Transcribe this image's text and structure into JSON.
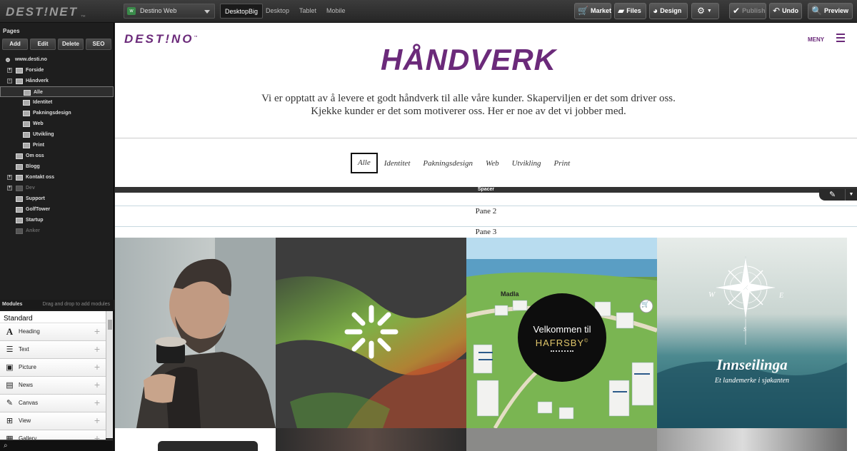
{
  "topbar": {
    "logo": "DEST!NET",
    "logo_tm": "™",
    "site_selector": "Destino Web",
    "site_icon": "w",
    "view_tabs": [
      "DesktopBig",
      "Desktop",
      "Tablet",
      "Mobile"
    ],
    "buttons": {
      "market": "Market",
      "files": "Files",
      "design": "Design",
      "publish": "Publish",
      "undo": "Undo",
      "preview": "Preview"
    }
  },
  "sidebar": {
    "pages_title": "Pages",
    "page_actions": [
      "Add",
      "Edit",
      "Delete",
      "SEO"
    ],
    "tree": [
      {
        "label": "www.desti.no",
        "level": 0,
        "expander": "",
        "icon": "globe"
      },
      {
        "label": "Forside",
        "level": 1,
        "expander": "+"
      },
      {
        "label": "Håndverk",
        "level": 1,
        "expander": "-"
      },
      {
        "label": "Alle",
        "level": 2,
        "expander": "",
        "selected": true
      },
      {
        "label": "Identitet",
        "level": 2,
        "expander": ""
      },
      {
        "label": "Pakningsdesign",
        "level": 2,
        "expander": ""
      },
      {
        "label": "Web",
        "level": 2,
        "expander": ""
      },
      {
        "label": "Utvikling",
        "level": 2,
        "expander": ""
      },
      {
        "label": "Print",
        "level": 2,
        "expander": ""
      },
      {
        "label": "Om oss",
        "level": 1,
        "expander": ""
      },
      {
        "label": "Blogg",
        "level": 1,
        "expander": ""
      },
      {
        "label": "Kontakt oss",
        "level": 1,
        "expander": "+"
      },
      {
        "label": "Dev",
        "level": 1,
        "expander": "+",
        "dim": true
      },
      {
        "label": "Support",
        "level": 1,
        "expander": ""
      },
      {
        "label": "GolfTower",
        "level": 1,
        "expander": ""
      },
      {
        "label": "Startup",
        "level": 1,
        "expander": ""
      },
      {
        "label": "Anker",
        "level": 1,
        "expander": "",
        "dim": true
      }
    ],
    "modules_title": "Modules",
    "modules_hint": "Drag and drop to add modules",
    "modules_group": "Standard",
    "modules": [
      {
        "label": "Heading",
        "icon": "A"
      },
      {
        "label": "Text",
        "icon": "text"
      },
      {
        "label": "Picture",
        "icon": "picture"
      },
      {
        "label": "News",
        "icon": "news"
      },
      {
        "label": "Canvas",
        "icon": "canvas"
      },
      {
        "label": "View",
        "icon": "view"
      },
      {
        "label": "Gallery",
        "icon": "gallery"
      }
    ]
  },
  "page": {
    "brand": "DEST!NO",
    "brand_tm": "™",
    "menu_label": "MENY",
    "hero_title": "HÅNDVERK",
    "intro_line1": "Vi er opptatt av å levere et godt håndverk til alle våre kunder. Skaperviljen er det som driver oss.",
    "intro_line2": "Kjekke kunder er det som motiverer oss. Her er noe av det vi jobber med.",
    "filters": [
      "Alle",
      "Identitet",
      "Pakningsdesign",
      "Web",
      "Utvikling",
      "Print"
    ],
    "active_filter": "Alle",
    "spacer_label": "Spacer",
    "pane2": "Pane 2",
    "pane3": "Pane 3",
    "tiles": {
      "hafrsby_line1": "Velkommen til",
      "hafrsby_line2": "HAFRSBY",
      "hafrsby_reg": "©",
      "map_label": "Madla",
      "compass_w": "W",
      "compass_e": "E",
      "compass_s": "S",
      "innseilinga_title": "Innseilinga",
      "innseilinga_sub": "Et landemerke i sjøkanten"
    }
  },
  "colors": {
    "brand_purple": "#6b2a7a",
    "toolbar_bg": "#2e2e2e",
    "sidebar_bg": "#1e1e1e"
  }
}
